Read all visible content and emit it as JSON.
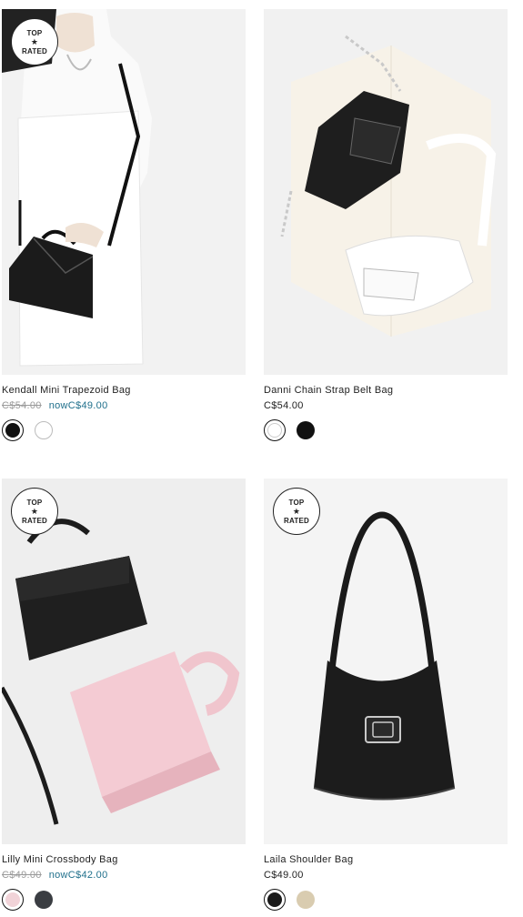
{
  "badge": {
    "line1": "TOP",
    "star": "★",
    "line2": "RATED"
  },
  "colors": {
    "sale_price": "#1f6f8b",
    "strike_price": "#9a9a9a"
  },
  "products": [
    {
      "name": "Kendall Mini Trapezoid Bag",
      "original_price": "C$54.00",
      "now_label": "now",
      "price": "C$49.00",
      "top_rated": true,
      "swatches": [
        {
          "color": "#111111",
          "selected": true
        },
        {
          "color": "#ffffff",
          "selected": false
        }
      ]
    },
    {
      "name": "Danni Chain Strap Belt Bag",
      "price": "C$54.00",
      "top_rated": false,
      "swatches": [
        {
          "color": "#ffffff",
          "selected": true
        },
        {
          "color": "#111111",
          "selected": false
        }
      ]
    },
    {
      "name": "Lilly Mini Crossbody Bag",
      "original_price": "C$49.00",
      "now_label": "now",
      "price": "C$42.00",
      "top_rated": true,
      "swatches": [
        {
          "color": "#f1d3d8",
          "selected": true
        },
        {
          "color": "#3a3d42",
          "selected": false
        }
      ]
    },
    {
      "name": "Laila Shoulder Bag",
      "price": "C$49.00",
      "top_rated": true,
      "swatches": [
        {
          "color": "#1a1a1a",
          "selected": true
        },
        {
          "color": "#d9ccb0",
          "selected": false
        }
      ]
    }
  ]
}
